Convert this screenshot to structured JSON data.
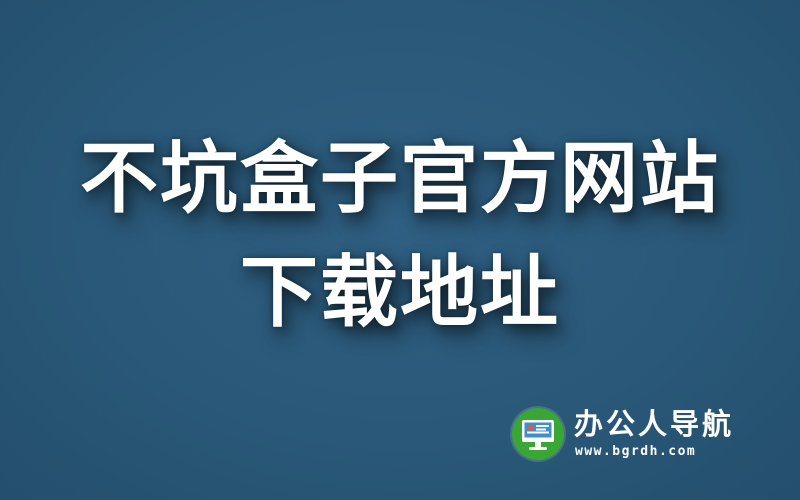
{
  "banner": {
    "background_color": "#2a5878",
    "headline": {
      "line1": "不坑盒子官方网站",
      "line2": "下载地址",
      "color": "#ffffff"
    },
    "brand": {
      "name": "办公人导航",
      "url": "www.bgrdh.com",
      "icon": "monitor-icon",
      "icon_bg_color": "#3aa635"
    }
  }
}
